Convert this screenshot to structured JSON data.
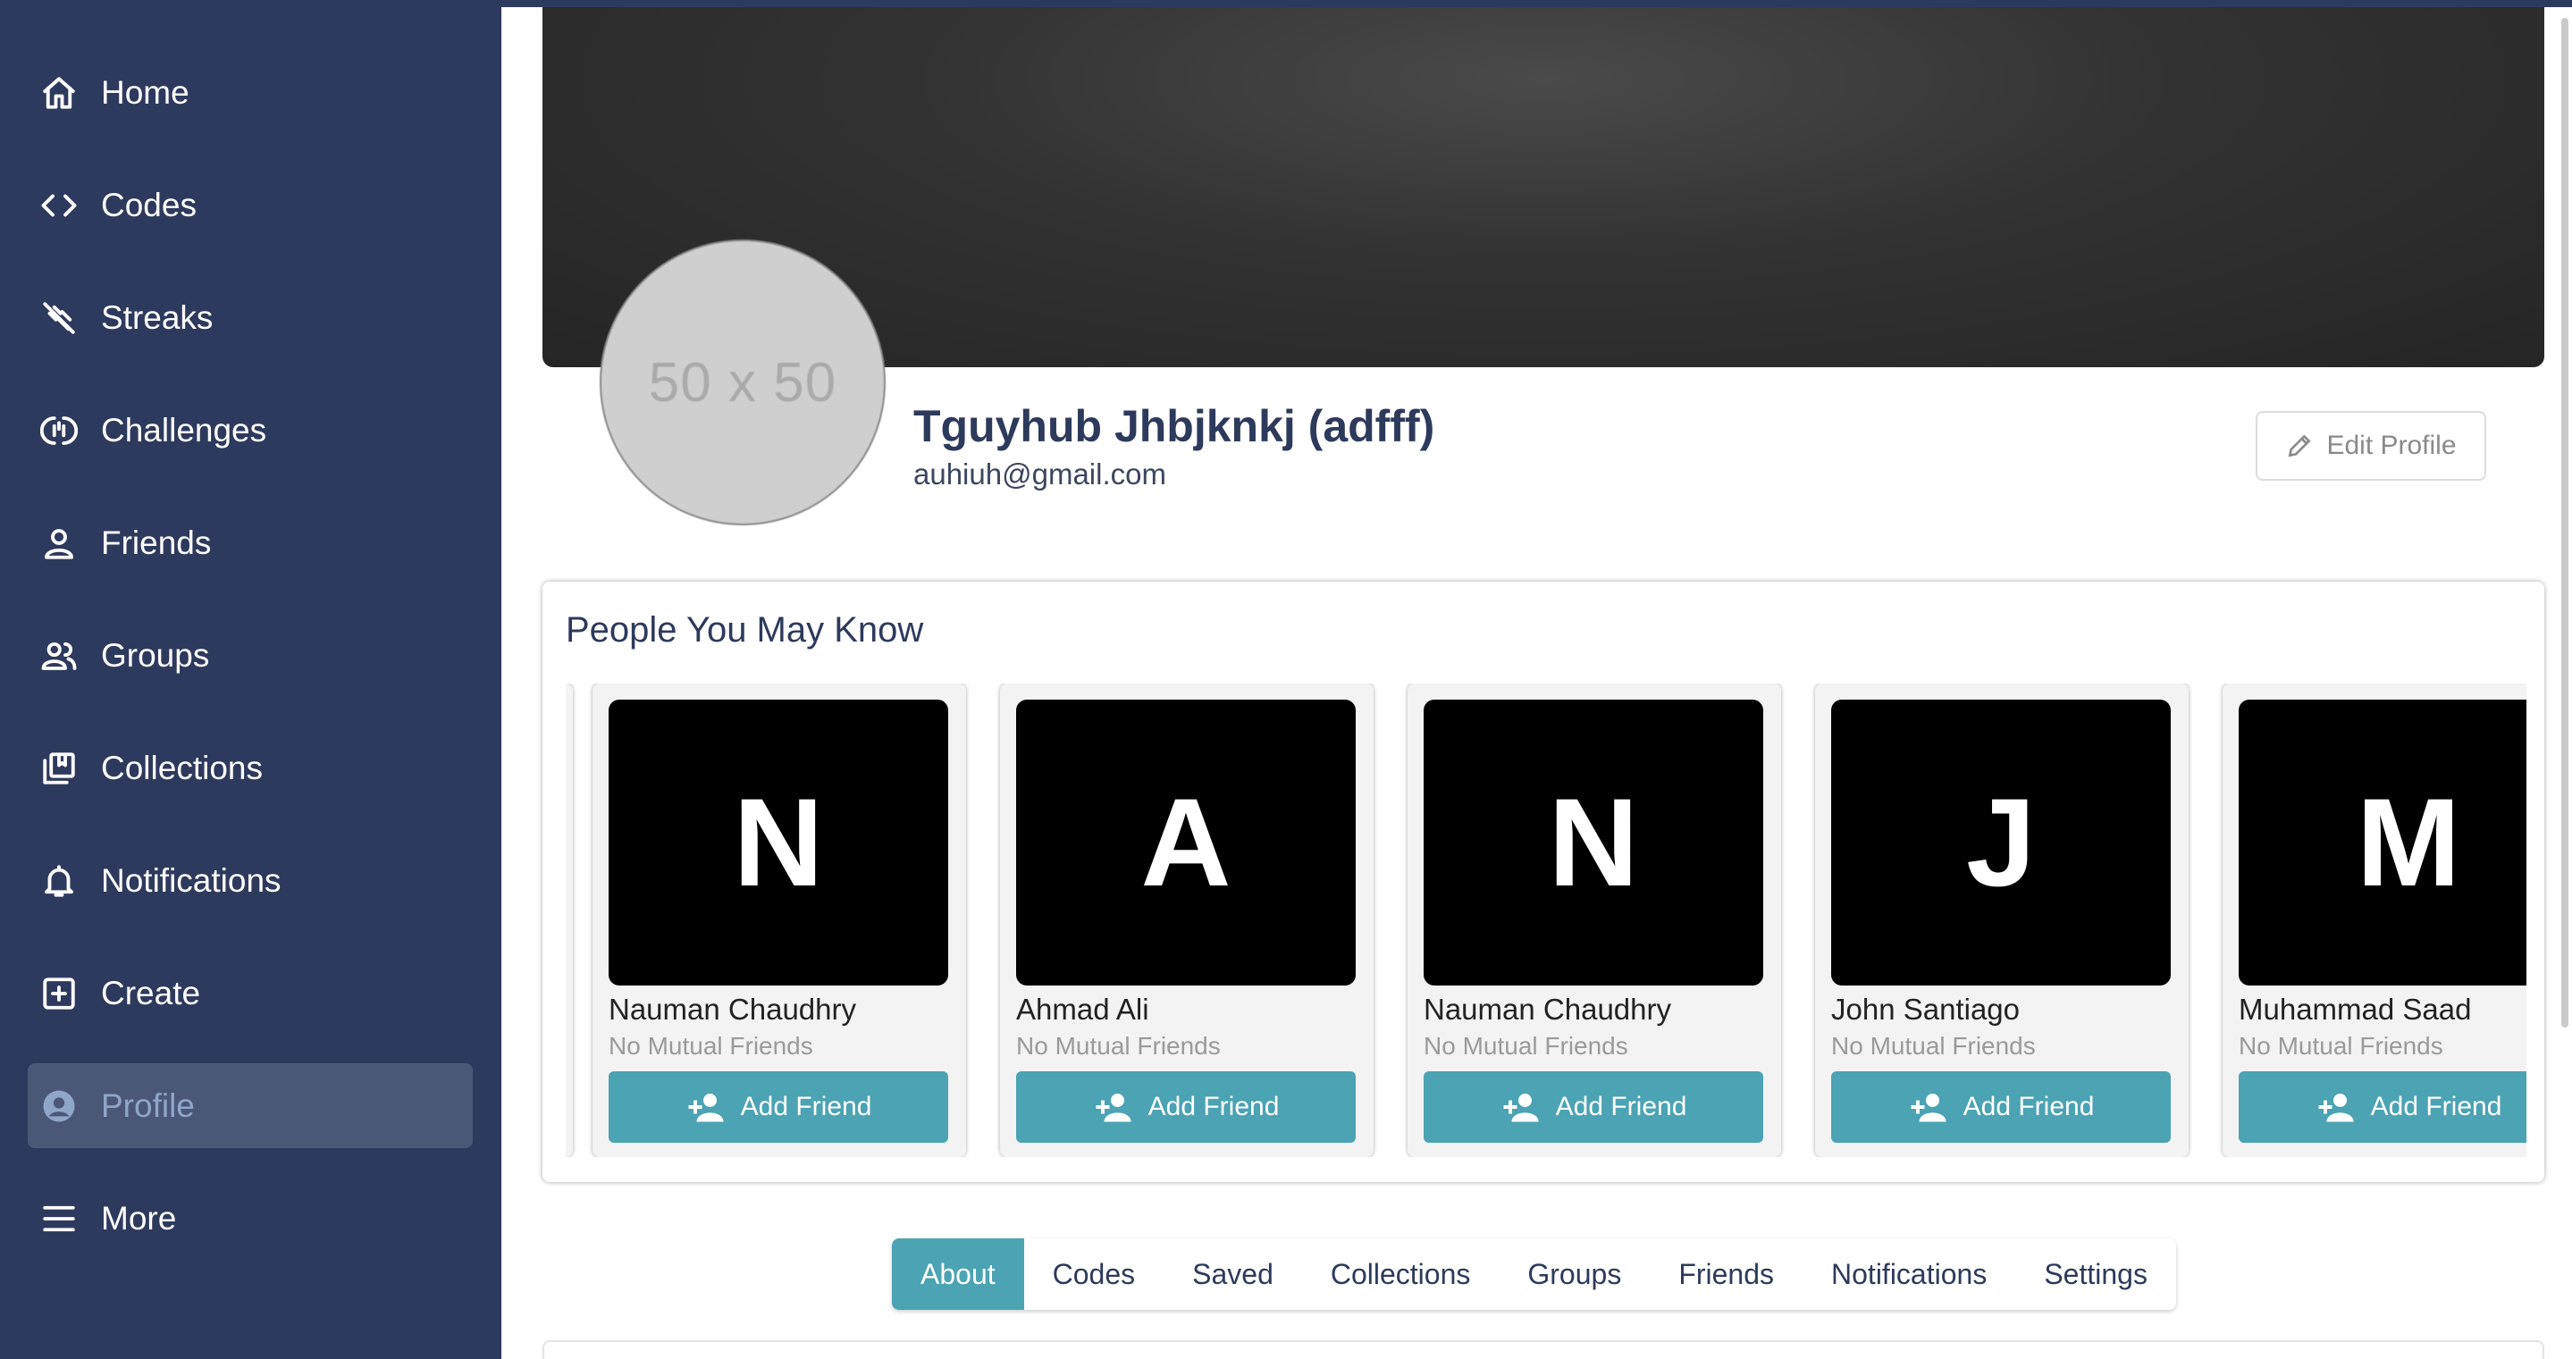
{
  "sidebar": {
    "items": [
      {
        "label": "Home",
        "icon": "home-icon"
      },
      {
        "label": "Codes",
        "icon": "code-icon"
      },
      {
        "label": "Streaks",
        "icon": "streak-icon"
      },
      {
        "label": "Challenges",
        "icon": "challenge-icon"
      },
      {
        "label": "Friends",
        "icon": "person-icon"
      },
      {
        "label": "Groups",
        "icon": "group-icon"
      },
      {
        "label": "Collections",
        "icon": "collections-icon"
      },
      {
        "label": "Notifications",
        "icon": "bell-icon"
      },
      {
        "label": "Create",
        "icon": "plus-square-icon"
      },
      {
        "label": "Profile",
        "icon": "user-circle-icon",
        "active": true
      },
      {
        "label": "More",
        "icon": "menu-icon"
      }
    ]
  },
  "profile": {
    "avatar_placeholder": "50 x 50",
    "name": "Tguyhub Jhbjknkj (adfff)",
    "email": "auhiuh@gmail.com",
    "edit_label": "Edit Profile"
  },
  "pymk": {
    "title": "People You May Know",
    "cards": [
      {
        "initial": "N",
        "name": "Nauman Chaudhry",
        "mutual": "No Mutual Friends",
        "button": "Add Friend"
      },
      {
        "initial": "A",
        "name": "Ahmad Ali",
        "mutual": "No Mutual Friends",
        "button": "Add Friend"
      },
      {
        "initial": "N",
        "name": "Nauman Chaudhry",
        "mutual": "No Mutual Friends",
        "button": "Add Friend"
      },
      {
        "initial": "J",
        "name": "John Santiago",
        "mutual": "No Mutual Friends",
        "button": "Add Friend"
      },
      {
        "initial": "M",
        "name": "Muhammad Saad",
        "mutual": "No Mutual Friends",
        "button": "Add Friend"
      }
    ]
  },
  "tabs": [
    "About",
    "Codes",
    "Saved",
    "Collections",
    "Groups",
    "Friends",
    "Notifications",
    "Settings"
  ],
  "colors": {
    "sidebar_bg": "#2e3a5d",
    "accent": "#4ba3b3",
    "active_nav": "#4a5777"
  }
}
